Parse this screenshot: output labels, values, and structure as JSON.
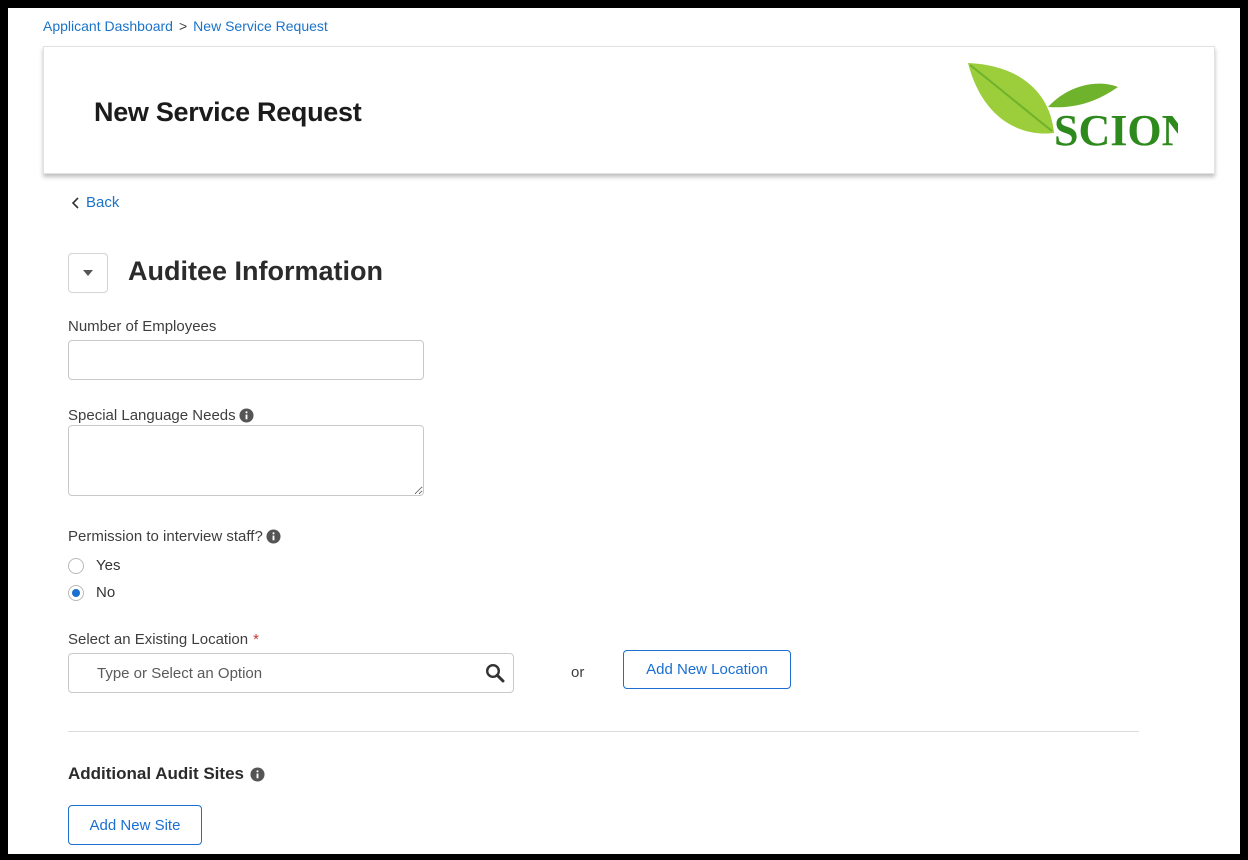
{
  "breadcrumb": {
    "items": [
      "Applicant Dashboard",
      "New Service Request"
    ],
    "separator": ">"
  },
  "header": {
    "title": "New Service Request",
    "logo_text": "SCION",
    "logo_colors": {
      "leaf_light": "#9ccd3a",
      "leaf_dark": "#6fb22c",
      "text": "#2f8a1e"
    }
  },
  "back_label": "Back",
  "section": {
    "title": "Auditee Information",
    "toggle_icon": "caret-down-icon"
  },
  "fields": {
    "employees": {
      "label": "Number of Employees",
      "value": "",
      "placeholder": ""
    },
    "language": {
      "label": "Special Language Needs",
      "value": "",
      "placeholder": ""
    },
    "interview": {
      "label": "Permission to interview staff?",
      "options": [
        {
          "label": "Yes",
          "selected": false
        },
        {
          "label": "No",
          "selected": true
        }
      ]
    },
    "location": {
      "label": "Select an Existing Location",
      "required_mark": "*",
      "placeholder": "Type or Select an Option",
      "or_text": "or",
      "add_button": "Add New Location"
    }
  },
  "additional_sites": {
    "title": "Additional Audit Sites",
    "add_button": "Add New Site"
  },
  "colors": {
    "link": "#1a73c8",
    "primary": "#1a6fd1",
    "required": "#c23934"
  }
}
